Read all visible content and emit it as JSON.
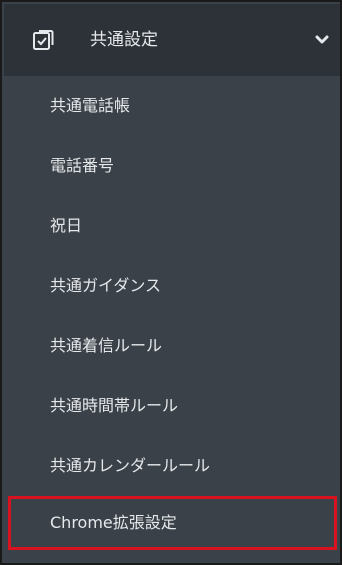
{
  "header": {
    "icon": "checkbox-icon",
    "title": "共通設定",
    "chevron_icon": "chevron-down-icon"
  },
  "menu": {
    "items": [
      {
        "label": "共通電話帳"
      },
      {
        "label": "電話番号"
      },
      {
        "label": "祝日"
      },
      {
        "label": "共通ガイダンス"
      },
      {
        "label": "共通着信ルール"
      },
      {
        "label": "共通時間帯ルール"
      },
      {
        "label": "共通カレンダールール"
      },
      {
        "label": "Chrome拡張設定",
        "highlighted": true
      }
    ]
  },
  "colors": {
    "panel_bg": "#3b4148",
    "header_bg": "#2d3238",
    "text": "#e6e9ec",
    "highlight_border": "#d8121f"
  }
}
